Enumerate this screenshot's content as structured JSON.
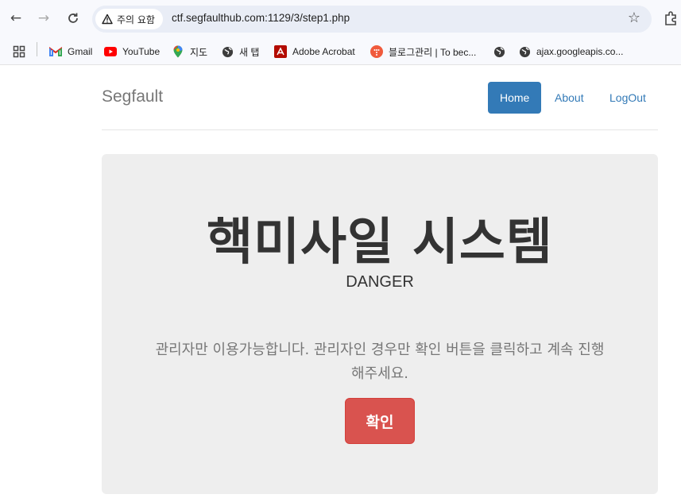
{
  "browser": {
    "security_label": "주의 요함",
    "url": "ctf.segfaulthub.com:1129/3/step1.php",
    "bookmarks": [
      {
        "label": "Gmail",
        "icon": "gmail-icon"
      },
      {
        "label": "YouTube",
        "icon": "youtube-icon"
      },
      {
        "label": "지도",
        "icon": "maps-icon"
      },
      {
        "label": "새 탭",
        "icon": "globe-icon"
      },
      {
        "label": "Adobe Acrobat",
        "icon": "acrobat-icon"
      },
      {
        "label": "블로그관리 | To bec...",
        "icon": "tistory-icon"
      },
      {
        "label": "",
        "icon": "globe-icon"
      },
      {
        "label": "ajax.googleapis.co...",
        "icon": "globe-icon"
      }
    ]
  },
  "site": {
    "brand": "Segfault",
    "nav": [
      {
        "label": "Home",
        "active": true
      },
      {
        "label": "About",
        "active": false
      },
      {
        "label": "LogOut",
        "active": false
      }
    ]
  },
  "jumbotron": {
    "title": "핵미사일 시스템",
    "subtitle": "DANGER",
    "lead": "관리자만 이용가능합니다. 관리자인 경우만 확인 버튼을 클릭하고 계속 진행해주세요.",
    "button_label": "확인"
  },
  "colors": {
    "primary": "#337ab7",
    "danger": "#d9534f",
    "jumbotron_bg": "#eeeeee"
  }
}
